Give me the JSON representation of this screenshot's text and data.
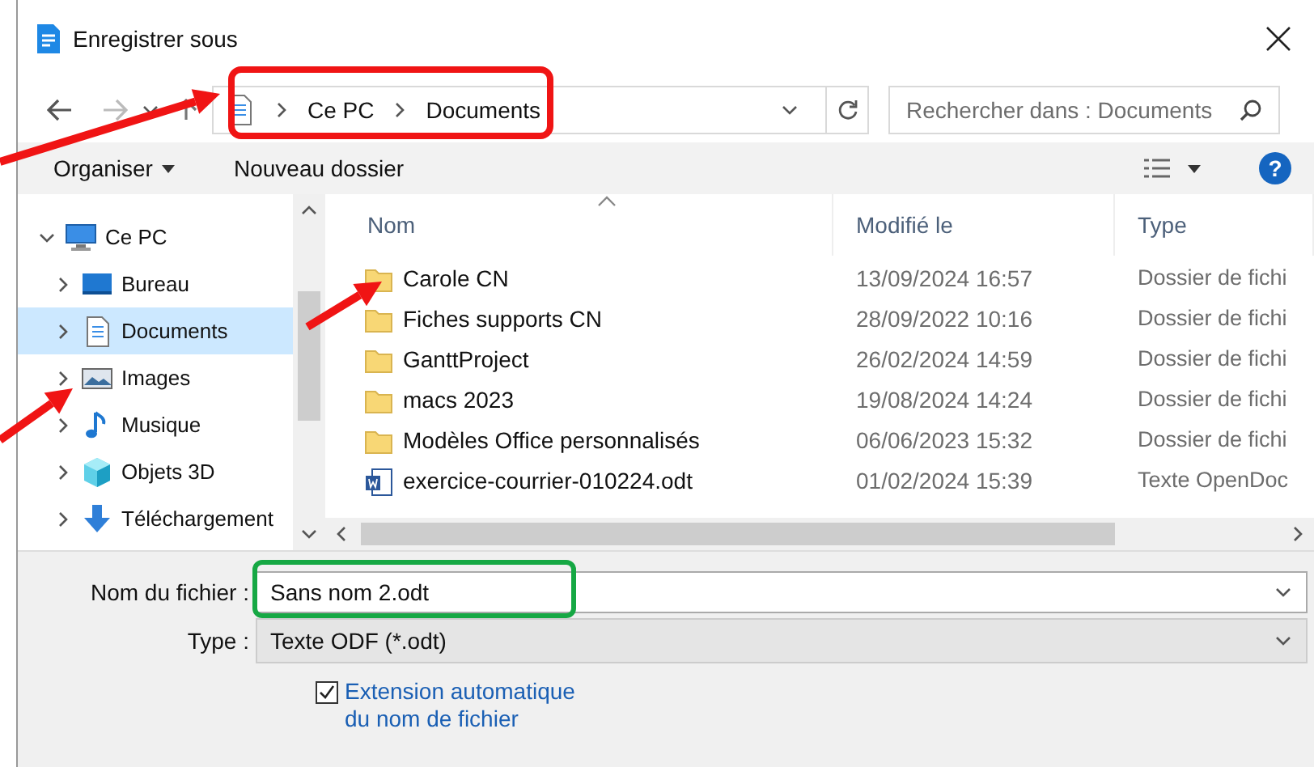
{
  "window": {
    "title": "Enregistrer sous"
  },
  "address_bar": {
    "path": [
      "Ce PC",
      "Documents"
    ]
  },
  "search": {
    "placeholder": "Rechercher dans : Documents"
  },
  "toolbar": {
    "organize": "Organiser",
    "new_folder": "Nouveau dossier",
    "help": "?"
  },
  "sidebar": {
    "items": [
      {
        "label": "Ce PC",
        "kind": "pc",
        "expanded": true,
        "selected": false,
        "children": [
          {
            "label": "Bureau",
            "kind": "desktop",
            "expanded": false,
            "selected": false
          },
          {
            "label": "Documents",
            "kind": "documents",
            "expanded": false,
            "selected": true
          },
          {
            "label": "Images",
            "kind": "images",
            "expanded": false,
            "selected": false
          },
          {
            "label": "Musique",
            "kind": "music",
            "expanded": false,
            "selected": false
          },
          {
            "label": "Objets 3D",
            "kind": "objects",
            "expanded": false,
            "selected": false
          },
          {
            "label": "Téléchargement",
            "kind": "downloads",
            "expanded": false,
            "selected": false
          }
        ]
      }
    ]
  },
  "table": {
    "columns": [
      "Nom",
      "Modifié le",
      "Type"
    ],
    "rows": [
      {
        "kind": "folder",
        "name": "Carole CN",
        "modified": "13/09/2024 16:57",
        "type": "Dossier de fichi"
      },
      {
        "kind": "folder",
        "name": "Fiches supports CN",
        "modified": "28/09/2022 10:16",
        "type": "Dossier de fichi"
      },
      {
        "kind": "folder",
        "name": "GanttProject",
        "modified": "26/02/2024 14:59",
        "type": "Dossier de fichi"
      },
      {
        "kind": "folder",
        "name": "macs 2023",
        "modified": "19/08/2024 14:24",
        "type": "Dossier de fichi"
      },
      {
        "kind": "folder",
        "name": "Modèles Office personnalisés",
        "modified": "06/06/2023 15:32",
        "type": "Dossier de fichi"
      },
      {
        "kind": "document",
        "name": "exercice-courrier-010224.odt",
        "modified": "01/02/2024 15:39",
        "type": "Texte OpenDoc"
      }
    ]
  },
  "file_name": {
    "label": "Nom du fichier :",
    "value": "Sans nom 2.odt"
  },
  "file_type": {
    "label": "Type :",
    "value": "Texte ODF (*.odt)"
  },
  "auto_extension": {
    "label": "Extension automatique du nom de fichier",
    "checked": true
  }
}
